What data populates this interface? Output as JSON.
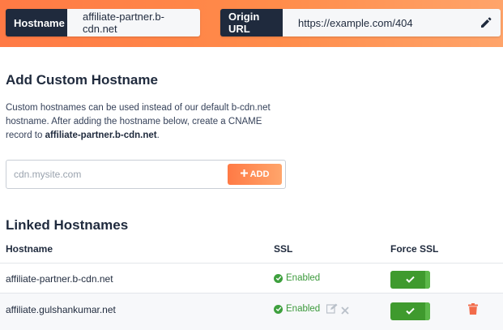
{
  "header": {
    "hostname_label": "Hostname",
    "hostname_value": "affiliate-partner.b-cdn.net",
    "origin_label": "Origin URL",
    "origin_value": "https://example.com/404"
  },
  "add_section": {
    "title": "Add Custom Hostname",
    "desc_line1": "Custom hostnames can be used instead of our default b-cdn.net",
    "desc_line2": "hostname. After adding the hostname below, create a CNAME",
    "desc_line3_prefix": "record to ",
    "desc_line3_bold": "affiliate-partner.b-cdn.net",
    "desc_line3_suffix": ".",
    "input_placeholder": "cdn.mysite.com",
    "input_value": "",
    "add_label": "ADD"
  },
  "linked_section": {
    "title": "Linked Hostnames",
    "columns": {
      "hostname": "Hostname",
      "ssl": "SSL",
      "force_ssl": "Force SSL"
    },
    "rows": [
      {
        "hostname": "affiliate-partner.b-cdn.net",
        "ssl": "Enabled",
        "force_ssl": true
      },
      {
        "hostname": "affiliate.gulshankumar.net",
        "ssl": "Enabled",
        "force_ssl": true
      }
    ]
  },
  "colors": {
    "accent_orange": "#ff7a45",
    "dark_label": "#1f2a3d",
    "success_green": "#3f9a2e",
    "delete_red": "#f26b4a"
  },
  "icons": [
    "pencil-icon",
    "plus-icon",
    "check-circle-icon",
    "edit-icon",
    "close-icon",
    "checkmark-icon",
    "trash-icon"
  ]
}
